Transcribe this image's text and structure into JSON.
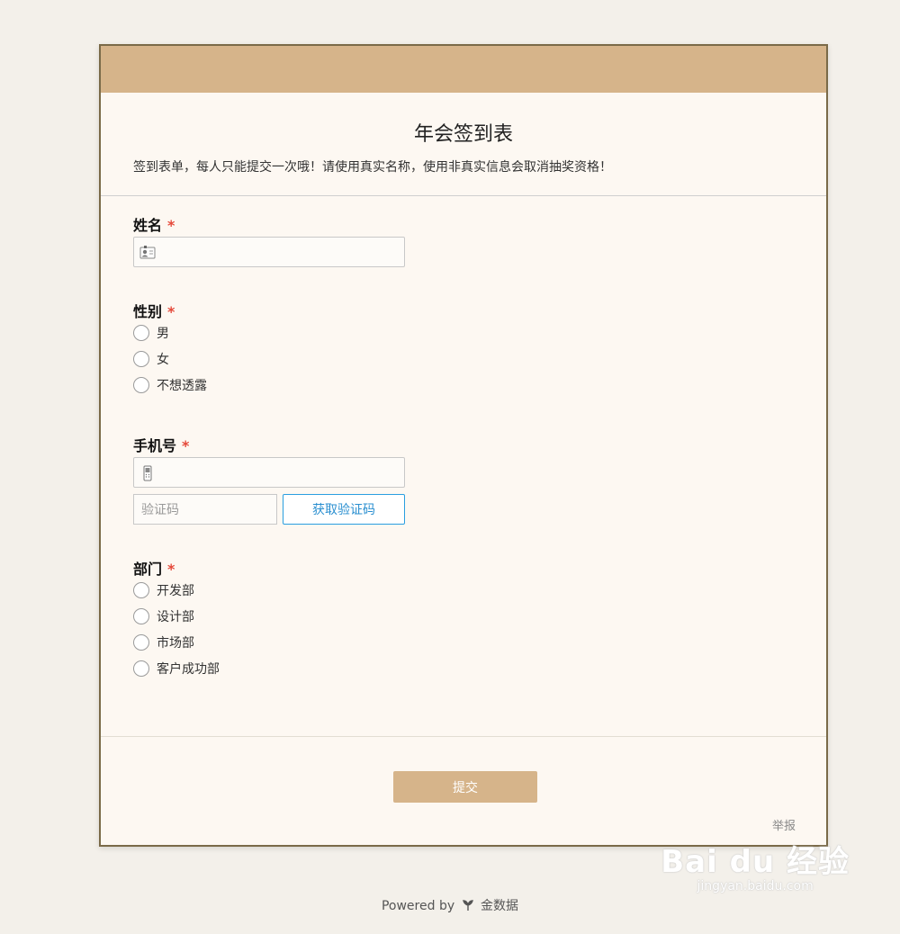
{
  "form": {
    "title": "年会签到表",
    "description": "签到表单，每人只能提交一次哦！请使用真实名称，使用非真实信息会取消抽奖资格！"
  },
  "fields": {
    "name": {
      "label": "姓名",
      "required_mark": "*",
      "icon": "id-card-icon"
    },
    "gender": {
      "label": "性别",
      "required_mark": "*",
      "options": [
        "男",
        "女",
        "不想透露"
      ]
    },
    "phone": {
      "label": "手机号",
      "required_mark": "*",
      "icon": "mobile-phone-icon",
      "code_placeholder": "验证码",
      "get_code_label": "获取验证码"
    },
    "department": {
      "label": "部门",
      "required_mark": "*",
      "options": [
        "开发部",
        "设计部",
        "市场部",
        "客户成功部"
      ]
    }
  },
  "actions": {
    "submit_label": "提交",
    "report_label": "举报"
  },
  "footer": {
    "powered_by": "Powered by",
    "brand": "金数据"
  },
  "watermark": {
    "main": "Bai du 经验",
    "sub": "jingyan.baidu.com"
  },
  "colors": {
    "accent": "#d6b48a",
    "border": "#7a6a48",
    "required": "#e5493a",
    "link_blue": "#2a9ee0"
  }
}
